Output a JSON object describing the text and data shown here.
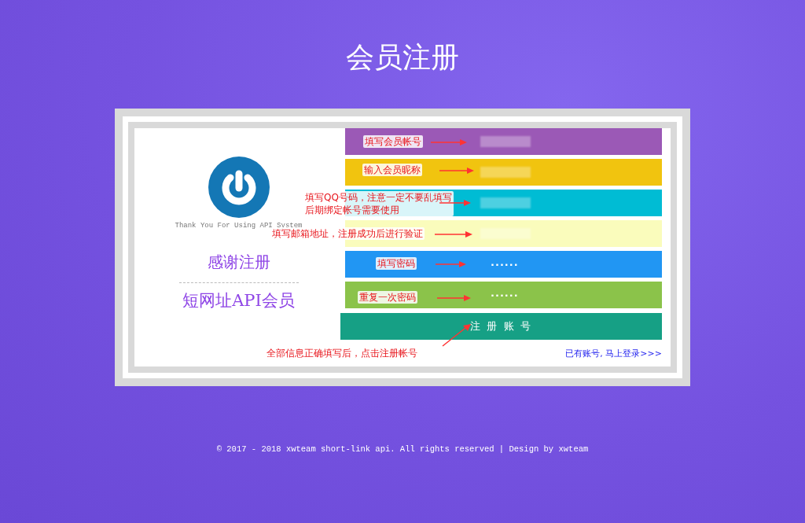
{
  "title": "会员注册",
  "logo": {
    "tagline": "Thank You For Using API System"
  },
  "intro": {
    "heading": "感谢注册",
    "subheading": "短网址API会员"
  },
  "fields": [
    {
      "kind": "blurred",
      "color": "#9b59b6",
      "note": [
        "填写会员帐号"
      ]
    },
    {
      "kind": "blurred",
      "color": "#f1c40f",
      "note": [
        "输入会员昵称"
      ]
    },
    {
      "kind": "blurred",
      "color": "#00bcd4",
      "note": [
        "填写QQ号码，注意一定不要乱填写",
        "后期绑定帐号需要使用"
      ]
    },
    {
      "kind": "blurred",
      "color": "#fafcbc",
      "note": [
        "填写邮箱地址，注册成功后进行验证"
      ]
    },
    {
      "kind": "password",
      "color": "#2196f3",
      "value": "······",
      "note": [
        "填写密码"
      ]
    },
    {
      "kind": "password",
      "color": "#8bc34a",
      "value": "······",
      "note": [
        "重复一次密码"
      ]
    }
  ],
  "submit": {
    "label": "注 册 账 号",
    "note": "全部信息正确填写后，点击注册帐号"
  },
  "login_link": "已有账号, 马上登录>>>",
  "footer": "© 2017 - 2018 xwteam short-link api. All rights reserved | Design by xwteam"
}
